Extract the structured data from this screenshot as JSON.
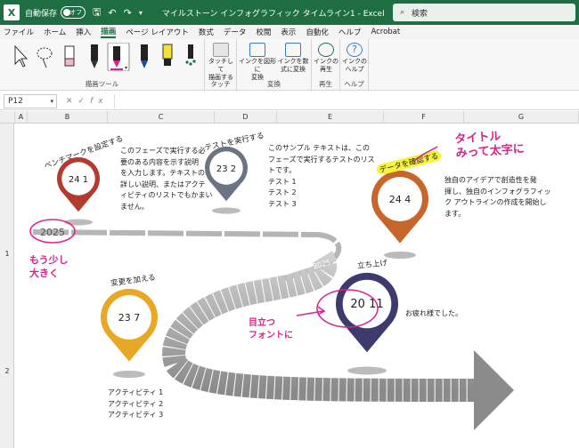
{
  "titlebar": {
    "app_icon": "X",
    "autosave_label": "自動保存",
    "autosave_state": "オフ",
    "doc_title": "マイルストーン インフォグラフィック タイムライン1 - Excel",
    "search_placeholder": "検索"
  },
  "tabs": [
    "ファイル",
    "ホーム",
    "挿入",
    "描画",
    "ページ レイアウト",
    "数式",
    "データ",
    "校閲",
    "表示",
    "自動化",
    "ヘルプ",
    "Acrobat"
  ],
  "ribbon": {
    "group_draw_tools": "描画ツール",
    "group_touch": "タッチ",
    "group_convert": "変換",
    "group_replay": "再生",
    "group_help": "ヘルプ",
    "touch_btn": "タッチして\n描画する",
    "ink_to_shape": "インクを図形に\n変換",
    "ink_to_math": "インクを数\n式に変換",
    "ink_replay": "インクの\n再生",
    "ink_help": "インクの\nヘルプ"
  },
  "formula": {
    "name_box": "P12",
    "fx": "fx"
  },
  "columns": [
    "A",
    "B",
    "C",
    "D",
    "E",
    "F",
    "G"
  ],
  "rows": [
    "1",
    "2"
  ],
  "timeline": {
    "milestones": [
      {
        "label": "ベンチマークを設定する",
        "date": "24 1",
        "color": "#b23a2e"
      },
      {
        "label": "テストを実行する",
        "date": "23 2",
        "color": "#6b7482"
      },
      {
        "label": "データを確認する",
        "date": "24 4",
        "color": "#c8652a"
      },
      {
        "label": "変更を加える",
        "date": "23 7",
        "color": "#e8a826"
      },
      {
        "label": "立ち上げ",
        "date": "20 11",
        "color": "#3f3a6e"
      }
    ],
    "desc1": "このフェーズで実行する必\n要のある内容を示す説明\nを入力します。テキストの\n詳しい説明、またはアクテ\nィビティのリストでもかまい\nません。",
    "desc2": "このサンプル テキストは、この\nフェーズで実行するテストのリス\nトです。\nテスト 1\nテスト 2\nテスト 3",
    "desc3": "独自のアイデアで創造性を発\n揮し、独自のインフォグラフィッ\nク アウトラインの作成を開始し\nます。",
    "desc4": "アクティビティ 1\nアクティビティ 2\nアクティビティ 3",
    "desc5": "お疲れ様でした。",
    "year1": "2025",
    "year2": "2025"
  },
  "annotations": {
    "a1": "タイトル\nみって太字に",
    "a2": "もう少し\n大きく",
    "a3": "目立つ\nフォントに"
  }
}
